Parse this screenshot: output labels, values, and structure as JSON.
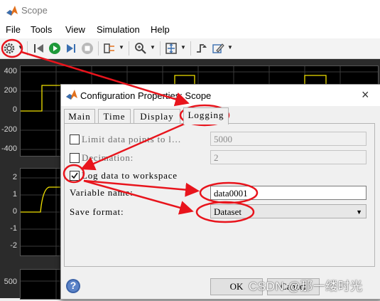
{
  "window": {
    "title": "Scope"
  },
  "menu": {
    "items": [
      "File",
      "Tools",
      "View",
      "Simulation",
      "Help"
    ]
  },
  "scope": {
    "plot1_ticks": [
      "400",
      "200",
      "0",
      "-200",
      "-400"
    ],
    "plot2_ticks": [
      "2",
      "1",
      "0",
      "-1",
      "-2"
    ],
    "plot3_ticks": [
      "500"
    ],
    "line_color": "#f0e000"
  },
  "dialog": {
    "title": "Configuration Properties: Scope",
    "close_glyph": "×",
    "tabs": [
      "Main",
      "Time",
      "Display",
      "Logging"
    ],
    "active_tab": "Logging",
    "limit_label": "Limit data points to l…",
    "limit_value": "5000",
    "decimation_label": "Decimation:",
    "decimation_value": "2",
    "log_label": "Log data to workspace",
    "log_checked": true,
    "varname_label": "Variable name:",
    "varname_value": "data0001",
    "format_label": "Save format:",
    "format_value": "Dataset",
    "ok_label": "OK",
    "cancel_label": "Cancel",
    "help_glyph": "?"
  },
  "annotation_color": "#e8141c",
  "watermark": "CSDN @那一缕时光"
}
